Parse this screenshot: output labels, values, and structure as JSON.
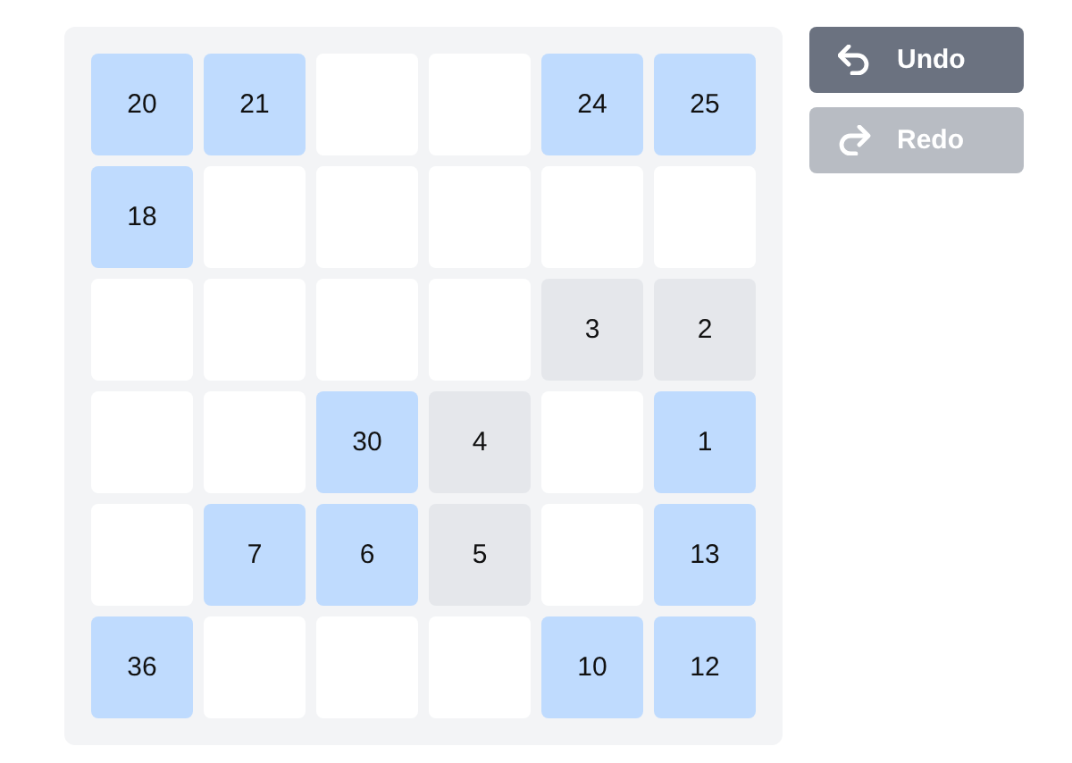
{
  "board": {
    "rows": [
      [
        {
          "label": "20",
          "color": "#bfdbfe"
        },
        {
          "label": "21",
          "color": "#bfdbfe"
        },
        {
          "color": "#ffffff"
        },
        {
          "color": "#ffffff"
        },
        {
          "label": "24",
          "color": "#bfdbfe"
        },
        {
          "label": "25",
          "color": "#bfdbfe"
        }
      ],
      [
        {
          "label": "18",
          "color": "#bfdbfe"
        },
        {
          "color": "#ffffff"
        },
        {
          "color": "#ffffff"
        },
        {
          "color": "#ffffff"
        },
        {
          "color": "#ffffff"
        },
        {
          "color": "#ffffff"
        }
      ],
      [
        {
          "color": "#ffffff"
        },
        {
          "color": "#ffffff"
        },
        {
          "color": "#ffffff"
        },
        {
          "color": "#ffffff"
        },
        {
          "label": "3",
          "color": "#e5e7eb"
        },
        {
          "label": "2",
          "color": "#e5e7eb"
        }
      ],
      [
        {
          "color": "#ffffff"
        },
        {
          "color": "#ffffff"
        },
        {
          "label": "30",
          "color": "#bfdbfe"
        },
        {
          "label": "4",
          "color": "#e5e7eb"
        },
        {
          "color": "#ffffff"
        },
        {
          "label": "1",
          "color": "#bfdbfe"
        }
      ],
      [
        {
          "color": "#ffffff"
        },
        {
          "label": "7",
          "color": "#bfdbfe"
        },
        {
          "label": "6",
          "color": "#bfdbfe"
        },
        {
          "label": "5",
          "color": "#e5e7eb"
        },
        {
          "color": "#ffffff"
        },
        {
          "label": "13",
          "color": "#bfdbfe"
        }
      ],
      [
        {
          "label": "36",
          "color": "#bfdbfe"
        },
        {
          "color": "#ffffff"
        },
        {
          "color": "#ffffff"
        },
        {
          "color": "#ffffff"
        },
        {
          "label": "10",
          "color": "#bfdbfe"
        },
        {
          "label": "12",
          "color": "#bfdbfe"
        }
      ]
    ]
  },
  "buttons": [
    {
      "kind": "undo",
      "label": "Undo",
      "disabled": false
    },
    {
      "kind": "redo",
      "label": "Redo",
      "disabled": true
    }
  ]
}
